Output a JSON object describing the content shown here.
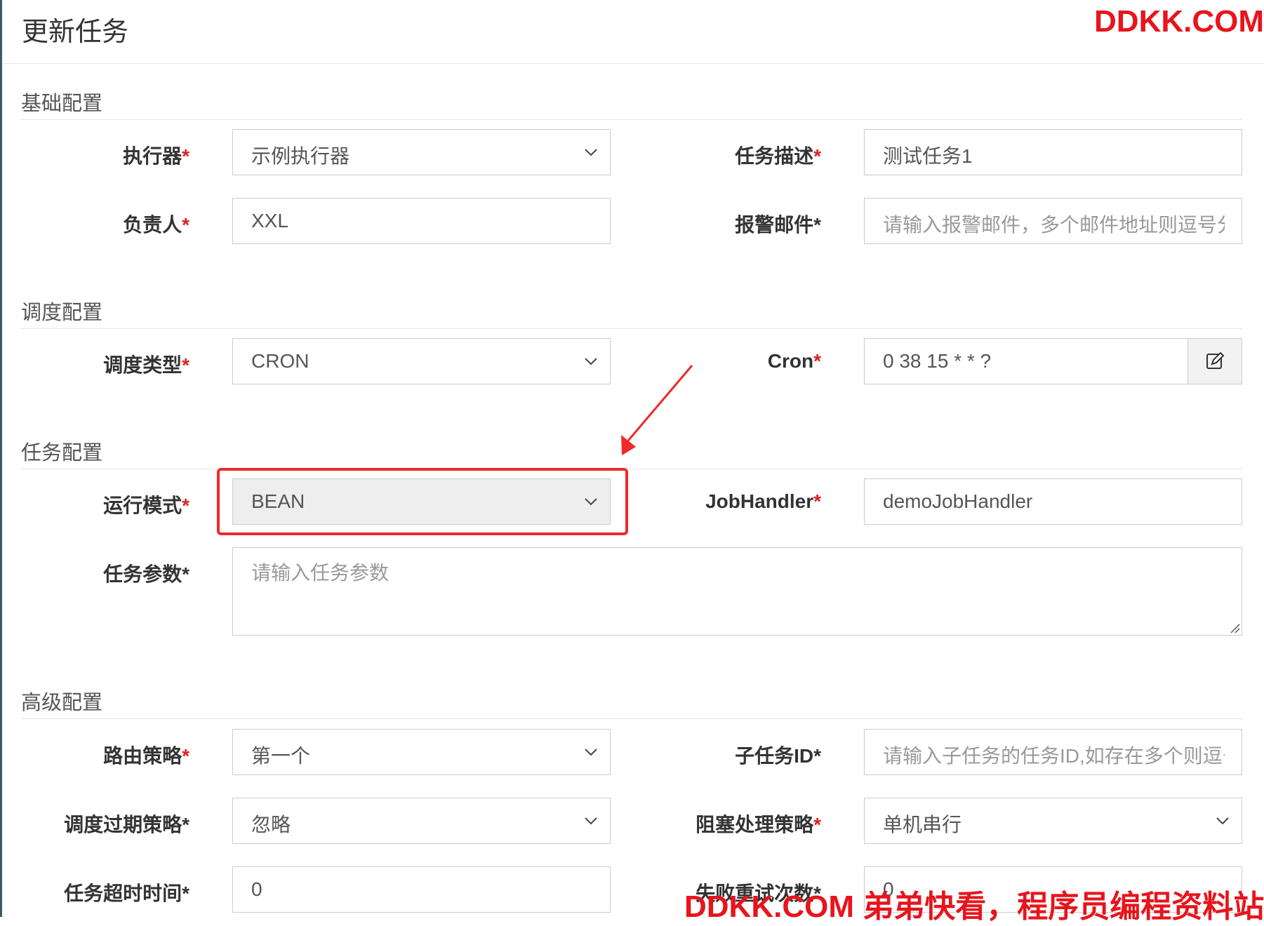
{
  "modal": {
    "title": "更新任务"
  },
  "watermark": {
    "top": "DDKK.COM",
    "bottom": "DDKK.COM 弟弟快看，程序员编程资料站"
  },
  "sections": {
    "basic": "基础配置",
    "schedule": "调度配置",
    "task": "任务配置",
    "advanced": "高级配置"
  },
  "fields": {
    "executor": {
      "label": "执行器",
      "value": "示例执行器"
    },
    "job_desc": {
      "label": "任务描述",
      "value": "测试任务1"
    },
    "author": {
      "label": "负责人",
      "value": "XXL"
    },
    "alarm_email": {
      "label": "报警邮件",
      "placeholder": "请输入报警邮件，多个邮件地址则逗号分"
    },
    "schedule_type": {
      "label": "调度类型",
      "value": "CRON"
    },
    "cron": {
      "label": "Cron",
      "value": "0 38 15 * * ?"
    },
    "glue_type": {
      "label": "运行模式",
      "value": "BEAN"
    },
    "job_handler": {
      "label": "JobHandler",
      "value": "demoJobHandler"
    },
    "job_param": {
      "label": "任务参数",
      "placeholder": "请输入任务参数"
    },
    "route_strategy": {
      "label": "路由策略",
      "value": "第一个"
    },
    "child_job_id": {
      "label": "子任务ID",
      "placeholder": "请输入子任务的任务ID,如存在多个则逗号分隔"
    },
    "misfire_strategy": {
      "label": "调度过期策略",
      "value": "忽略"
    },
    "block_strategy": {
      "label": "阻塞处理策略",
      "value": "单机串行"
    },
    "timeout": {
      "label": "任务超时时间",
      "value": "0"
    },
    "fail_retry": {
      "label": "失败重试次数",
      "value": "0"
    }
  },
  "required_mark": "*",
  "colors": {
    "required": "#e02020",
    "highlight": "#ef2a2a",
    "watermark": "#e8141c"
  },
  "icons": {
    "select": "chevron-down-icon",
    "cron_edit": "edit-icon"
  }
}
